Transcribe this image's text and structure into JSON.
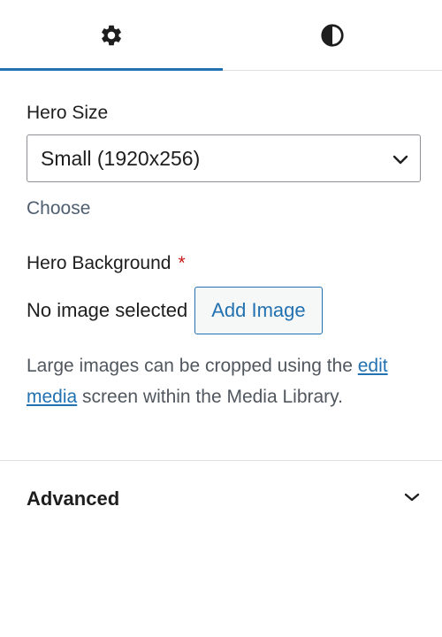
{
  "tabs": [
    {
      "icon": "gear-icon",
      "active": true
    },
    {
      "icon": "contrast-icon",
      "active": false
    }
  ],
  "hero_size": {
    "label": "Hero Size",
    "selected": "Small (1920x256)",
    "choose_label": "Choose"
  },
  "hero_background": {
    "label": "Hero Background",
    "required_mark": "*",
    "no_image_text": "No image selected",
    "add_image_label": "Add Image",
    "help_text_prefix": "Large images can be cropped using the ",
    "help_link_text": "edit media",
    "help_text_suffix": " screen within the Media Library."
  },
  "advanced": {
    "title": "Advanced",
    "icon": "chevron-down-icon"
  },
  "colors": {
    "accent": "#2271b1",
    "required": "#cc1818",
    "muted_text": "#50575e",
    "border": "#e0e0e0"
  }
}
